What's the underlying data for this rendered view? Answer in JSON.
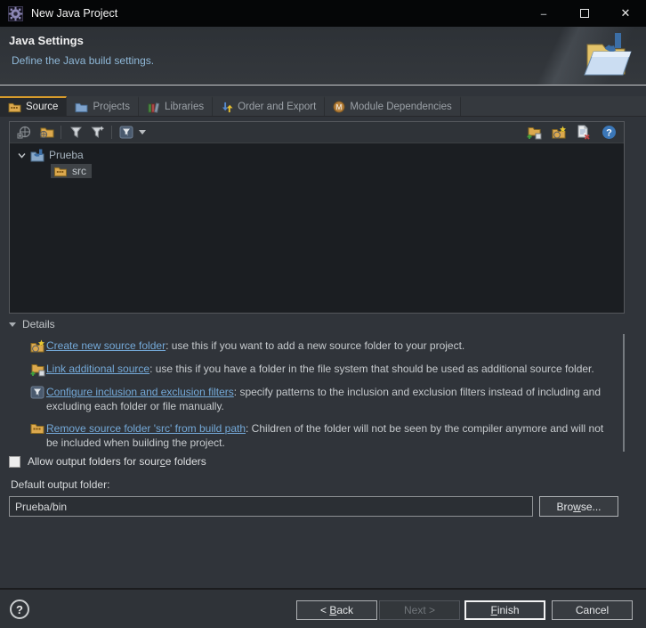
{
  "window": {
    "title": "New Java Project",
    "minimize_glyph": "–",
    "close_glyph": "✕"
  },
  "header": {
    "title": "Java Settings",
    "subtitle": "Define the Java build settings."
  },
  "tabs": [
    {
      "label": "Source",
      "active": true
    },
    {
      "label": "Projects",
      "active": false
    },
    {
      "label": "Libraries",
      "active": false
    },
    {
      "label": "Order and Export",
      "active": false
    },
    {
      "label": "Module Dependencies",
      "active": false,
      "badge": "M"
    }
  ],
  "tree": {
    "root_label": "Prueba",
    "child_label": "src"
  },
  "details": {
    "header": "Details",
    "items": [
      {
        "link": "Create new source folder",
        "desc": ": use this if you want to add a new source folder to your project."
      },
      {
        "link": "Link additional source",
        "desc": ": use this if you have a folder in the file system that should be used as additional source folder."
      },
      {
        "link": "Configure inclusion and exclusion filters",
        "desc": ": specify patterns to the inclusion and exclusion filters instead of including and excluding each folder or file manually."
      },
      {
        "link": "Remove source folder 'src' from build path",
        "desc": ": Children of the folder will not be seen by the compiler anymore and will not be included when building the project."
      }
    ]
  },
  "output": {
    "checkbox_label": {
      "pre": "Allow output folders for sour",
      "mnemonic": "c",
      "post": "e folders"
    },
    "folder_label": "Default output folder:",
    "folder_value": "Prueba/bin",
    "browse": {
      "pre": "Bro",
      "mnemonic": "w",
      "post": "se..."
    }
  },
  "footer": {
    "back": {
      "pre": "< ",
      "mnemonic": "B",
      "post": "ack"
    },
    "next_label": "Next >",
    "finish": {
      "mnemonic": "F",
      "post": "inish"
    },
    "cancel_label": "Cancel",
    "help_glyph": "?"
  },
  "colors": {
    "tab_accent": "#D79B2C",
    "link": "#74A9D8",
    "subtitle": "#8FB8D8",
    "help_icon_blue": "#3B77B8"
  }
}
